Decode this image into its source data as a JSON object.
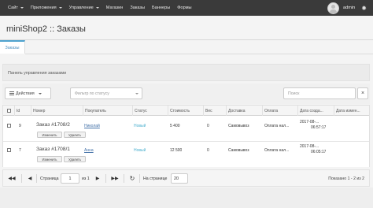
{
  "topnav": {
    "items": [
      {
        "label": "Сайт",
        "caret": true
      },
      {
        "label": "Приложения",
        "caret": true
      },
      {
        "label": "Управление",
        "caret": true
      },
      {
        "label": "Магазин",
        "caret": false
      },
      {
        "label": "Заказы",
        "caret": false
      },
      {
        "label": "Баннеры",
        "caret": false
      },
      {
        "label": "Формы",
        "caret": false
      }
    ],
    "user": "admin",
    "settings_icon": "gear-icon"
  },
  "page": {
    "title": "miniShop2 :: Заказы",
    "tab": "Заказы",
    "panel_label": "Панель управления заказами"
  },
  "toolbar": {
    "actions_label": "Действия",
    "status_placeholder": "Фильтр по статусу",
    "search_placeholder": "Поиск",
    "clear_label": "×"
  },
  "grid": {
    "columns": [
      "Id",
      "Номер",
      "Покупатель",
      "Статус",
      "Стоимость",
      "Вес",
      "Доставка",
      "Оплата",
      "Дата созда...",
      "Дата измен..."
    ],
    "rows": [
      {
        "id": "9",
        "num": "Заказ #1708/2",
        "customer": "Николай",
        "status": "Новый",
        "cost": "5 400",
        "weight": "0",
        "delivery": "Самовывоз",
        "payment": "Оплата нал...",
        "created_date": "2017-08-...",
        "created_time": "06:57:17",
        "updated": "",
        "btn_edit": "Изменить",
        "btn_delete": "Удалить"
      },
      {
        "id": "7",
        "num": "Заказ #1708/1",
        "customer": "Анна",
        "status": "Новый",
        "cost": "12 500",
        "weight": "0",
        "delivery": "Самовывоз",
        "payment": "Оплата нал...",
        "created_date": "2017-08-...",
        "created_time": "06:05:17",
        "updated": "",
        "btn_edit": "Изменить",
        "btn_delete": "Удалить"
      }
    ]
  },
  "pager": {
    "page_label": "Страница",
    "page_value": "1",
    "of_label": "из 1",
    "per_page_label": "На странице",
    "per_page_value": "20",
    "info": "Показано 1 - 2 из 2"
  }
}
